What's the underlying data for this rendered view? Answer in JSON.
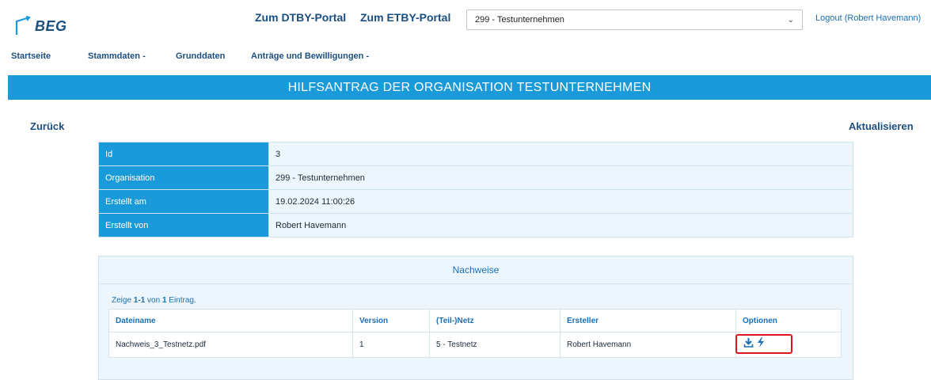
{
  "header": {
    "logo_text": "BEG",
    "links": [
      "Zum DTBY-Portal",
      "Zum ETBY-Portal"
    ],
    "organisation_select": "299 - Testunternehmen",
    "logout": "Logout (Robert Havemann)"
  },
  "nav": {
    "items": [
      "Startseite",
      "Stammdaten -",
      "Grunddaten",
      "Anträge und Bewilligungen -"
    ]
  },
  "banner": {
    "title": "HILFSANTRAG DER ORGANISATION TESTUNTERNEHMEN"
  },
  "actions": {
    "back": "Zurück",
    "refresh": "Aktualisieren"
  },
  "detail": {
    "rows": [
      {
        "label": "Id",
        "value": "3"
      },
      {
        "label": "Organisation",
        "value": "299 - Testunternehmen"
      },
      {
        "label": "Erstellt am",
        "value": "19.02.2024 11:00:26"
      },
      {
        "label": "Erstellt von",
        "value": "Robert Havemann"
      }
    ]
  },
  "nachweise": {
    "title": "Nachweise",
    "summary_prefix": "Zeige ",
    "summary_range": "1-1",
    "summary_mid": " von ",
    "summary_total": "1",
    "summary_suffix": " Eintrag.",
    "columns": [
      "Dateiname",
      "Version",
      "(Teil-)Netz",
      "Ersteller",
      "Optionen"
    ],
    "rows": [
      {
        "dateiname": "Nachweis_3_Testnetz.pdf",
        "version": "1",
        "netz": "5 - Testnetz",
        "ersteller": "Robert Havemann"
      }
    ],
    "option_icons": [
      "download-icon",
      "lightning-icon"
    ],
    "highlight_color": "#e0141e"
  },
  "colors": {
    "accent": "#1a9ad9",
    "brand": "#1a4f80"
  }
}
